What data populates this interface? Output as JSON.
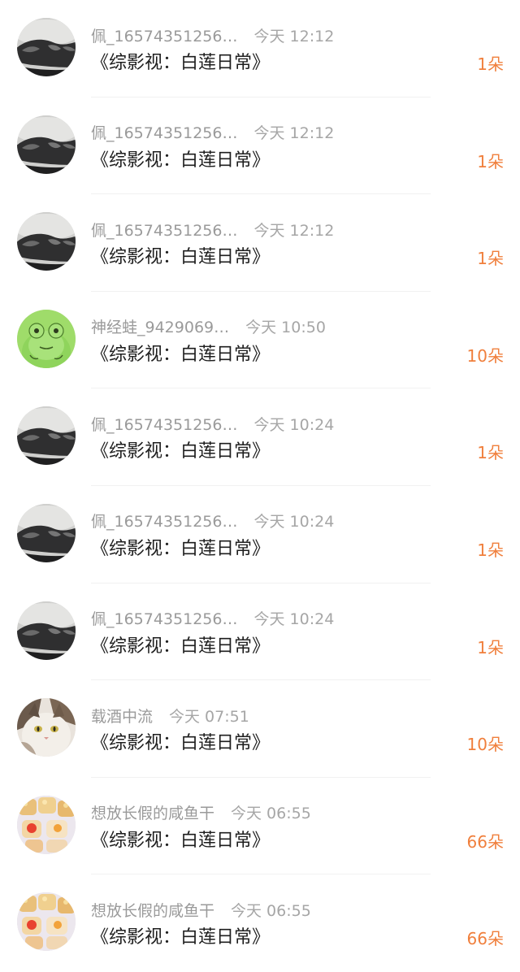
{
  "colors": {
    "accent": "#f07f3c",
    "meta_text": "#9a9a9a",
    "title_text": "#1e1e1e"
  },
  "records": [
    {
      "username": "佩_16574351256…",
      "time": "今天 12:12",
      "title": "《综影视：白莲日常》",
      "flowers": "1朵",
      "avatar": "shoe"
    },
    {
      "username": "佩_16574351256…",
      "time": "今天 12:12",
      "title": "《综影视：白莲日常》",
      "flowers": "1朵",
      "avatar": "shoe"
    },
    {
      "username": "佩_16574351256…",
      "time": "今天 12:12",
      "title": "《综影视：白莲日常》",
      "flowers": "1朵",
      "avatar": "shoe"
    },
    {
      "username": "神经蛙_9429069…",
      "time": "今天 10:50",
      "title": "《综影视：白莲日常》",
      "flowers": "10朵",
      "avatar": "frog"
    },
    {
      "username": "佩_16574351256…",
      "time": "今天 10:24",
      "title": "《综影视：白莲日常》",
      "flowers": "1朵",
      "avatar": "shoe"
    },
    {
      "username": "佩_16574351256…",
      "time": "今天 10:24",
      "title": "《综影视：白莲日常》",
      "flowers": "1朵",
      "avatar": "shoe"
    },
    {
      "username": "佩_16574351256…",
      "time": "今天 10:24",
      "title": "《综影视：白莲日常》",
      "flowers": "1朵",
      "avatar": "shoe"
    },
    {
      "username": "载酒中流",
      "time": "今天 07:51",
      "title": "《综影视：白莲日常》",
      "flowers": "10朵",
      "avatar": "cat"
    },
    {
      "username": "想放长假的咸鱼干",
      "time": "今天 06:55",
      "title": "《综影视：白莲日常》",
      "flowers": "66朵",
      "avatar": "food"
    },
    {
      "username": "想放长假的咸鱼干",
      "time": "今天 06:55",
      "title": "《综影视：白莲日常》",
      "flowers": "66朵",
      "avatar": "food"
    }
  ]
}
